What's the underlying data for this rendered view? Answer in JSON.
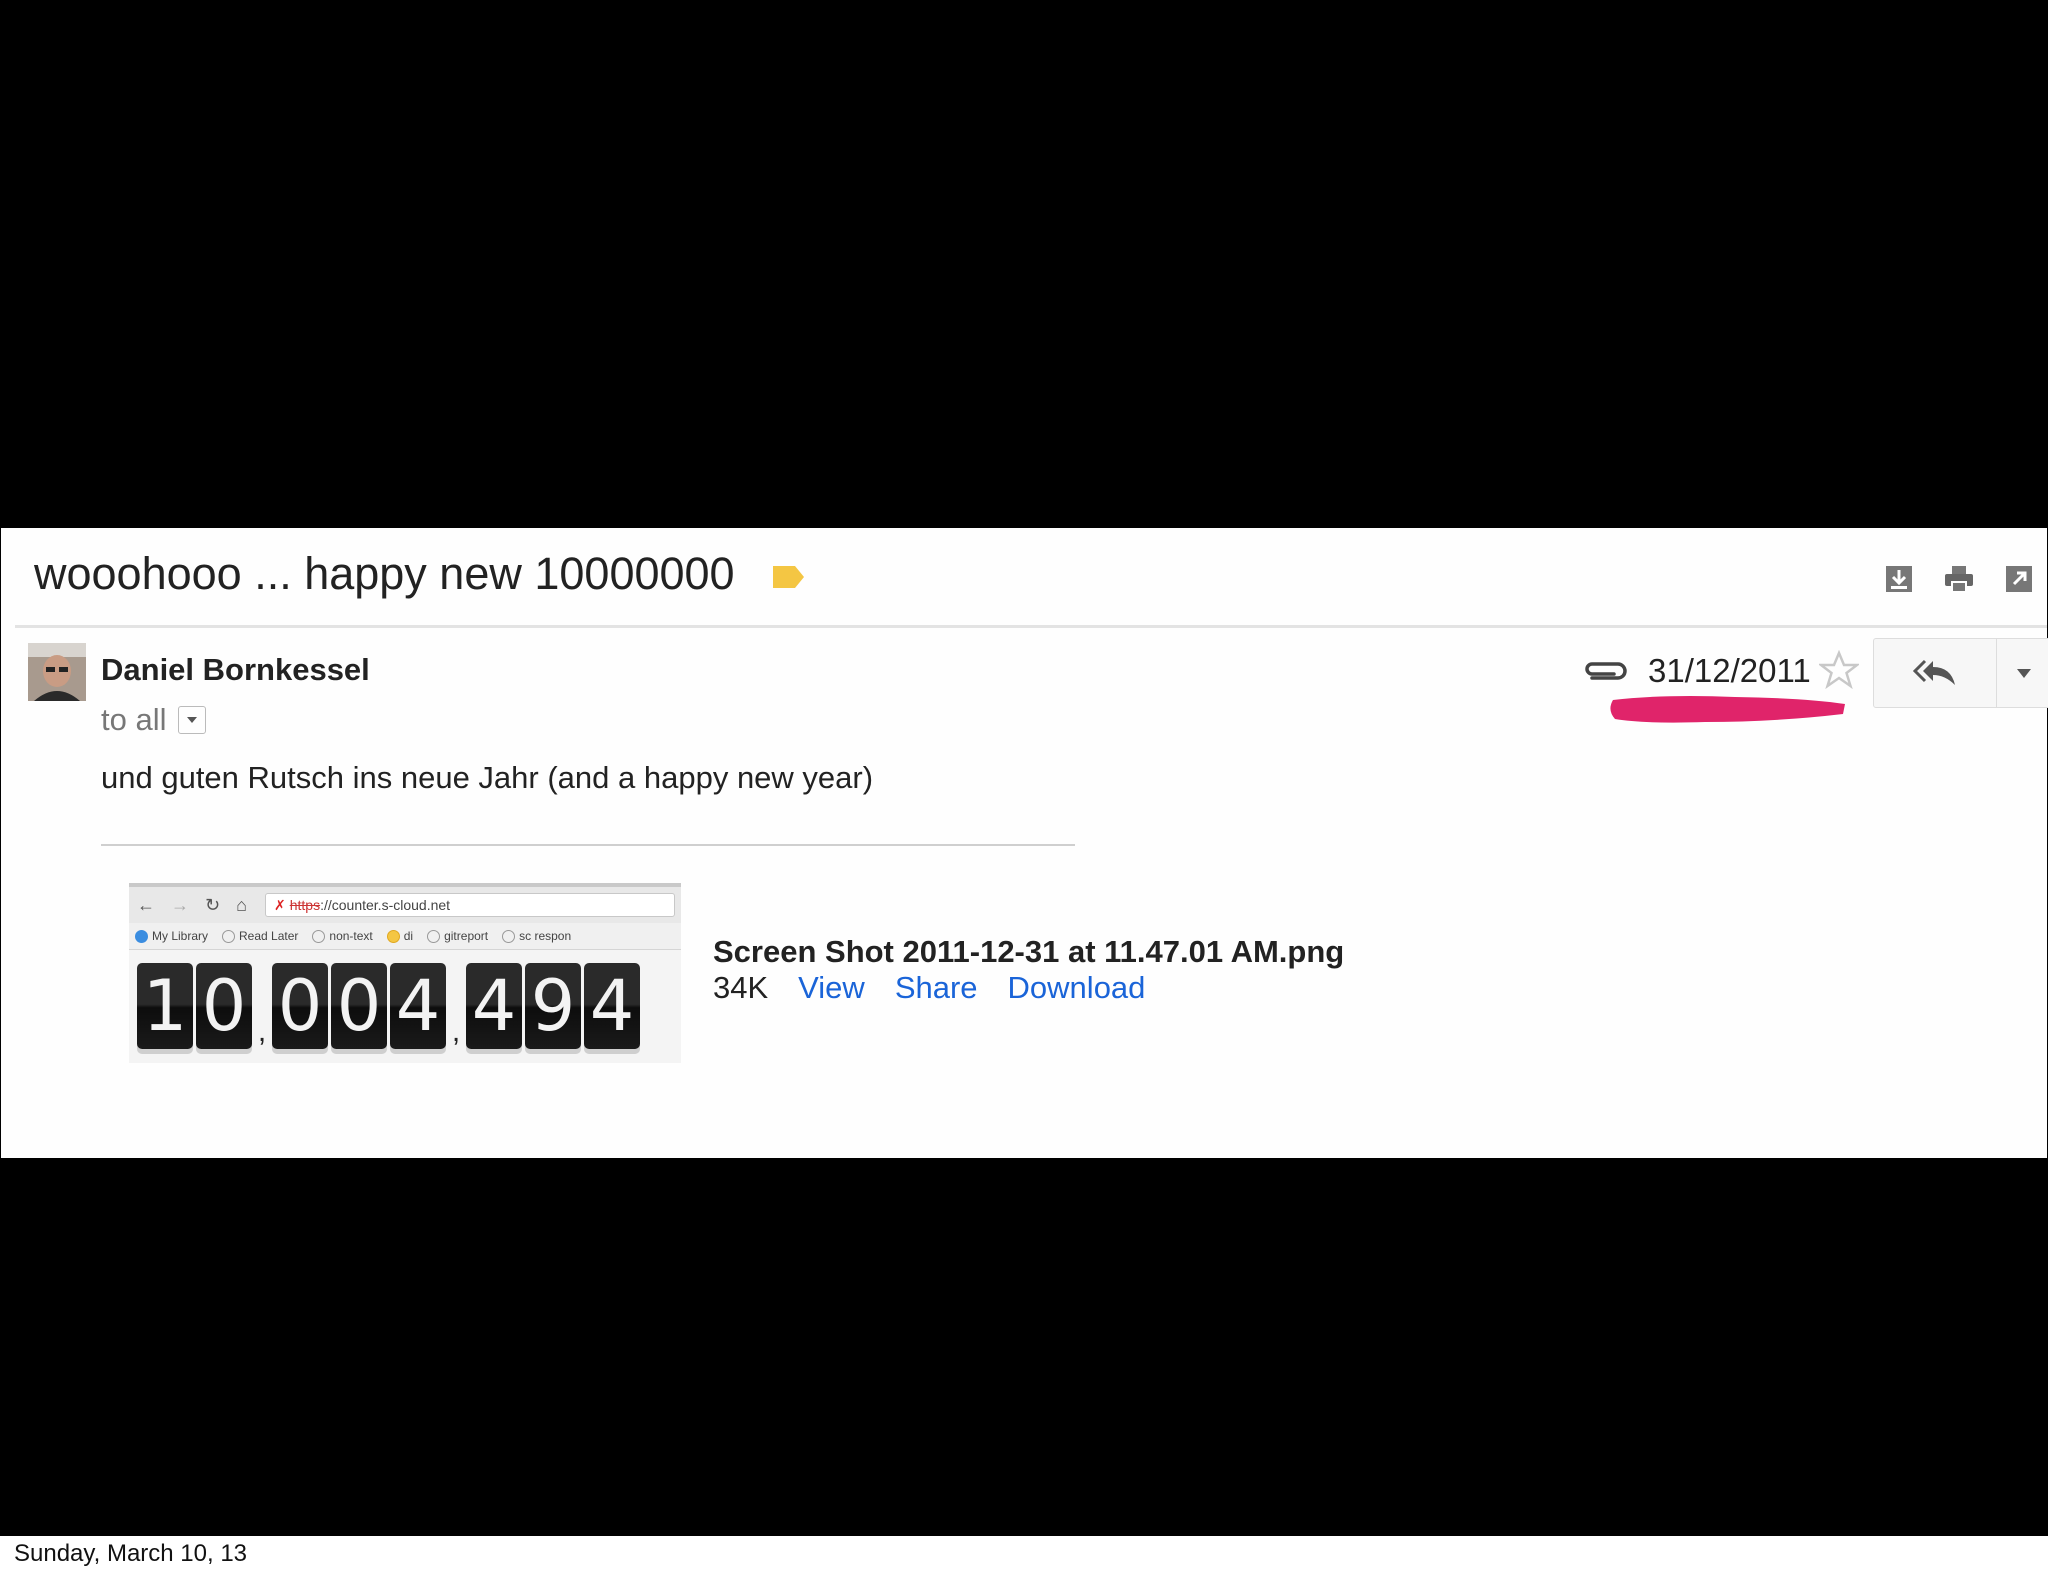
{
  "email": {
    "subject": "wooohooo ... happy new 10000000",
    "sender": "Daniel Bornkessel",
    "to": "to all",
    "date": "31/12/2011",
    "body": "und guten Rutsch ins neue Jahr (and a happy new year)",
    "colors": {
      "label": "#f4c643",
      "link": "#1a64d8",
      "highlight": "#e0246a"
    }
  },
  "attachment": {
    "filename": "Screen Shot 2011-12-31 at 11.47.01 AM.png",
    "size": "34K",
    "actions": [
      "View",
      "Share",
      "Download"
    ],
    "thumbnail": {
      "url_scheme": "https",
      "url_rest": "://counter.s-cloud.net",
      "bookmarks": [
        "My Library",
        "Read Later",
        "non-text",
        "di",
        "gitreport",
        "sc respon"
      ],
      "counter_digits": [
        "1",
        "0",
        "0",
        "0",
        "4",
        "4",
        "9",
        "4"
      ]
    }
  },
  "footer": {
    "date": "Sunday, March 10, 13"
  }
}
